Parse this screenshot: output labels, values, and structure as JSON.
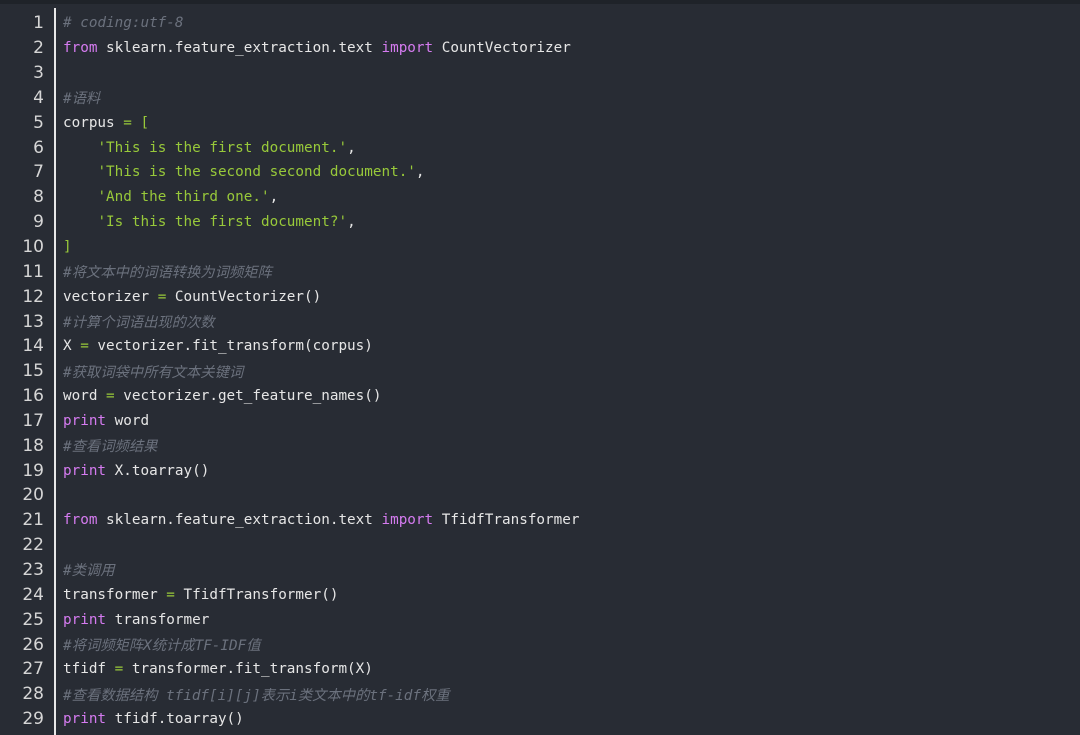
{
  "editor": {
    "lines": [
      {
        "n": "1",
        "tokens": [
          {
            "t": "cm",
            "v": "# coding:utf-8"
          }
        ]
      },
      {
        "n": "2",
        "tokens": [
          {
            "t": "kw",
            "v": "from"
          },
          {
            "t": "pl",
            "v": " sklearn.feature_extraction.text "
          },
          {
            "t": "kw",
            "v": "import"
          },
          {
            "t": "pl",
            "v": " CountVectorizer"
          }
        ]
      },
      {
        "n": "3",
        "tokens": []
      },
      {
        "n": "4",
        "tokens": [
          {
            "t": "cm",
            "v": "#语料"
          }
        ]
      },
      {
        "n": "5",
        "tokens": [
          {
            "t": "pl",
            "v": "corpus "
          },
          {
            "t": "op",
            "v": "="
          },
          {
            "t": "pl",
            "v": " "
          },
          {
            "t": "op",
            "v": "["
          }
        ]
      },
      {
        "n": "6",
        "tokens": [
          {
            "t": "pl",
            "v": "    "
          },
          {
            "t": "str",
            "v": "'This is the first document.'"
          },
          {
            "t": "pl",
            "v": ","
          }
        ]
      },
      {
        "n": "7",
        "tokens": [
          {
            "t": "pl",
            "v": "    "
          },
          {
            "t": "str",
            "v": "'This is the second second document.'"
          },
          {
            "t": "pl",
            "v": ","
          }
        ]
      },
      {
        "n": "8",
        "tokens": [
          {
            "t": "pl",
            "v": "    "
          },
          {
            "t": "str",
            "v": "'And the third one.'"
          },
          {
            "t": "pl",
            "v": ","
          }
        ]
      },
      {
        "n": "9",
        "tokens": [
          {
            "t": "pl",
            "v": "    "
          },
          {
            "t": "str",
            "v": "'Is this the first document?'"
          },
          {
            "t": "pl",
            "v": ","
          }
        ]
      },
      {
        "n": "10",
        "tokens": [
          {
            "t": "op",
            "v": "]"
          }
        ]
      },
      {
        "n": "11",
        "tokens": [
          {
            "t": "cm",
            "v": "#将文本中的词语转换为词频矩阵"
          }
        ]
      },
      {
        "n": "12",
        "tokens": [
          {
            "t": "pl",
            "v": "vectorizer "
          },
          {
            "t": "op",
            "v": "="
          },
          {
            "t": "pl",
            "v": " CountVectorizer()"
          }
        ]
      },
      {
        "n": "13",
        "tokens": [
          {
            "t": "cm",
            "v": "#计算个词语出现的次数"
          }
        ]
      },
      {
        "n": "14",
        "tokens": [
          {
            "t": "pl",
            "v": "X "
          },
          {
            "t": "op",
            "v": "="
          },
          {
            "t": "pl",
            "v": " vectorizer.fit_transform(corpus)"
          }
        ]
      },
      {
        "n": "15",
        "tokens": [
          {
            "t": "cm",
            "v": "#获取词袋中所有文本关键词"
          }
        ]
      },
      {
        "n": "16",
        "tokens": [
          {
            "t": "pl",
            "v": "word "
          },
          {
            "t": "op",
            "v": "="
          },
          {
            "t": "pl",
            "v": " vectorizer.get_feature_names()"
          }
        ]
      },
      {
        "n": "17",
        "tokens": [
          {
            "t": "kw",
            "v": "print"
          },
          {
            "t": "pl",
            "v": " word"
          }
        ]
      },
      {
        "n": "18",
        "tokens": [
          {
            "t": "cm",
            "v": "#查看词频结果"
          }
        ]
      },
      {
        "n": "19",
        "tokens": [
          {
            "t": "kw",
            "v": "print"
          },
          {
            "t": "pl",
            "v": " X.toarray()"
          }
        ]
      },
      {
        "n": "20",
        "tokens": []
      },
      {
        "n": "21",
        "tokens": [
          {
            "t": "kw",
            "v": "from"
          },
          {
            "t": "pl",
            "v": " sklearn.feature_extraction.text "
          },
          {
            "t": "kw",
            "v": "import"
          },
          {
            "t": "pl",
            "v": " TfidfTransformer"
          }
        ]
      },
      {
        "n": "22",
        "tokens": []
      },
      {
        "n": "23",
        "tokens": [
          {
            "t": "cm",
            "v": "#类调用"
          }
        ]
      },
      {
        "n": "24",
        "tokens": [
          {
            "t": "pl",
            "v": "transformer "
          },
          {
            "t": "op",
            "v": "="
          },
          {
            "t": "pl",
            "v": " TfidfTransformer()"
          }
        ]
      },
      {
        "n": "25",
        "tokens": [
          {
            "t": "kw",
            "v": "print"
          },
          {
            "t": "pl",
            "v": " transformer"
          }
        ]
      },
      {
        "n": "26",
        "tokens": [
          {
            "t": "cm",
            "v": "#将词频矩阵X统计成TF-IDF值"
          }
        ]
      },
      {
        "n": "27",
        "tokens": [
          {
            "t": "pl",
            "v": "tfidf "
          },
          {
            "t": "op",
            "v": "="
          },
          {
            "t": "pl",
            "v": " transformer.fit_transform(X)"
          }
        ]
      },
      {
        "n": "28",
        "tokens": [
          {
            "t": "cm",
            "v": "#查看数据结构 tfidf[i][j]表示i类文本中的tf-idf权重"
          }
        ]
      },
      {
        "n": "29",
        "tokens": [
          {
            "t": "kw",
            "v": "print"
          },
          {
            "t": "pl",
            "v": " tfidf.toarray()"
          }
        ]
      }
    ]
  },
  "colors": {
    "background": "#282c34",
    "keyword": "#d57bf0",
    "string": "#98c93a",
    "comment": "#6b717d",
    "plain": "#e6e6e6",
    "line_number": "#d6d6d6"
  }
}
